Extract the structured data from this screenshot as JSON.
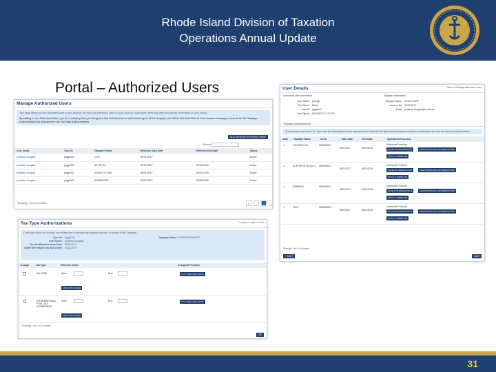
{
  "header": {
    "title_line1": "Rhode Island Division of Taxation",
    "title_line2": "Operations Annual Update"
  },
  "slide_title": "Portal – Authorized Users",
  "page_number": "31",
  "colors": {
    "header_bg": "#1f3f6e",
    "accent_gold": "#caa64a",
    "page_number": "#f2c94c",
    "info_bg": "#dbe8f5"
  },
  "manage": {
    "title": "Manage Authorized Users",
    "info_text": "This page allows you the authorized user to add, remove, the and edit authorized users for your account. Authorized users may view and access information on your behalf.",
    "info_text2": "By adding a new Authorized User, you are certifying that you designate that individual as an authorized agent of the taxpayer, and allow that individual to have access to taxpayer records for the Taxpayer Authorizations as indicated for the Tax Type Authorizations.",
    "add_button": "ADD NEW AUTHORIZED USER",
    "search_label": "Search",
    "columns": [
      "User Name",
      "User ID",
      "Taxpayer Name",
      "Effective Start Date",
      "Effective End Date",
      "Status"
    ],
    "rows": [
      [
        "jonathan.douglas",
        "jdgg5432",
        "TAXJ",
        "05/21/2017",
        "",
        "Active"
      ],
      [
        "jonathan.douglas",
        "jdgg5432",
        "NE DELTA",
        "05/21/2017",
        "05/21/2018",
        "Active"
      ],
      [
        "jonathan.douglas",
        "jdgg5432",
        "JOHN'S STORE",
        "05/21/2017",
        "05/21/2018",
        "Active"
      ],
      [
        "jonathan.douglas",
        "jdgg5432",
        "HOMECORP",
        "05/21/2017",
        "05/21/2018",
        "Active"
      ]
    ],
    "showing": "Showing 1 to 4 of 4 entries",
    "pager": [
      "«",
      "‹",
      "1",
      "›",
      "»"
    ]
  },
  "tax_type": {
    "title": "Tax Type Authorizations",
    "required_note": "* Indicates required field",
    "info_text": "Check the check box in each row of this form to perform the selected function on behalf of the Taxpayer.",
    "fields": [
      {
        "label": "User ID:",
        "value": "jdgg5432"
      },
      {
        "label": "User Name:",
        "value": "jonathan.douglas"
      },
      {
        "label": "Tax Identification Num Date:",
        "value": "05/21/2017"
      },
      {
        "label": "USER INFORMATION SEE DATE:",
        "value": "05/21/2017"
      }
    ],
    "taxpayer_name_label": "Taxpayer Name:",
    "taxpayer_name": "JOHNSON&WHITE",
    "columns": [
      "Assign",
      "Tax Type",
      "Effective Dates",
      "Assigned Function"
    ],
    "rows": [
      {
        "tax_type": "ALL/PIPE",
        "function": "TAX TYPE FUNCTIONS",
        "add": "ADD DATE RANGE",
        "start": "Start",
        "end": "End"
      },
      {
        "tax_type": "INTERNATIONAL FUEL TAX AGREEMENT",
        "function": "TAX TYPE FUNCTIONS",
        "add": "ADD DATE RANGE",
        "start": "Start",
        "end": "End"
      }
    ],
    "showing": "Showing 1 to 2 of 2 entries",
    "button": "OK"
  },
  "user_details": {
    "title": "User Details",
    "link": "Return to Manage Authorized Users",
    "left_header": "Authorized User Information",
    "right_header": "Taxpayer Information",
    "left_fields": [
      {
        "label": "User Name:",
        "value": "jdoedgl"
      },
      {
        "label": "First Name:",
        "value": "David"
      },
      {
        "label": "User ID:",
        "value": "jdgg5432"
      },
      {
        "label": "Last Sign In:",
        "value": "05/21/2017 10:32 PM"
      }
    ],
    "right_fields": [
      {
        "label": "Taxpayer Name:",
        "value": "DELTA CORP"
      },
      {
        "label": "Account No:",
        "value": "05/21/2017"
      },
      {
        "label": "Email:",
        "value": "jonathan.douglas@email.com"
      }
    ],
    "section": "Taxpayer Authorizations",
    "section_text": "Check the box next to each Tax Type to set the Authorizations for the authorized user. Select the Tax Type functions that you would like to authorize for this user and click Save Authorizations.",
    "columns": [
      "Auth",
      "Taxpayer Name",
      "Tax ID",
      "Start Date",
      "End Date",
      "Authorized Functions"
    ],
    "rows": [
      {
        "name": "JOHNSON TAX",
        "id": "0000000001",
        "start": "05/21/2017",
        "end": "05/21/2018",
        "func": "Authorized Functions"
      },
      {
        "name": "NORTHERN PLAZA TC",
        "id": "0000000002",
        "start": "05/21/2017",
        "end": "05/21/2018",
        "func": "Authorized Functions"
      },
      {
        "name": "MERIDIAN",
        "id": "0000000003",
        "start": "05/21/2017",
        "end": "05/21/2018",
        "func": "Authorized Functions"
      },
      {
        "name": "TAXD",
        "id": "0000000004",
        "start": "05/21/2017",
        "end": "05/21/2018",
        "func": "Authorized Functions"
      }
    ],
    "func_btn1": "SAVE AUTHORIZATIONS",
    "func_btn2": "VIEW PREVIOUS AUTHORIZATIONS",
    "func_btn3": "APPLY A TEMPLATE",
    "showing": "Showing 1 to 4 of 4 entries",
    "back_button": "« BACK",
    "save_button": "SAVE"
  }
}
